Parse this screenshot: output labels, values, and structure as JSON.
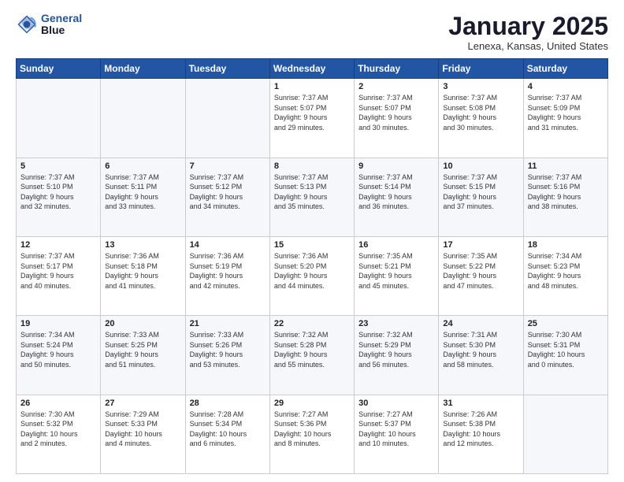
{
  "logo": {
    "line1": "General",
    "line2": "Blue"
  },
  "header": {
    "title": "January 2025",
    "subtitle": "Lenexa, Kansas, United States"
  },
  "weekdays": [
    "Sunday",
    "Monday",
    "Tuesday",
    "Wednesday",
    "Thursday",
    "Friday",
    "Saturday"
  ],
  "weeks": [
    [
      {
        "day": "",
        "info": ""
      },
      {
        "day": "",
        "info": ""
      },
      {
        "day": "",
        "info": ""
      },
      {
        "day": "1",
        "info": "Sunrise: 7:37 AM\nSunset: 5:07 PM\nDaylight: 9 hours\nand 29 minutes."
      },
      {
        "day": "2",
        "info": "Sunrise: 7:37 AM\nSunset: 5:07 PM\nDaylight: 9 hours\nand 30 minutes."
      },
      {
        "day": "3",
        "info": "Sunrise: 7:37 AM\nSunset: 5:08 PM\nDaylight: 9 hours\nand 30 minutes."
      },
      {
        "day": "4",
        "info": "Sunrise: 7:37 AM\nSunset: 5:09 PM\nDaylight: 9 hours\nand 31 minutes."
      }
    ],
    [
      {
        "day": "5",
        "info": "Sunrise: 7:37 AM\nSunset: 5:10 PM\nDaylight: 9 hours\nand 32 minutes."
      },
      {
        "day": "6",
        "info": "Sunrise: 7:37 AM\nSunset: 5:11 PM\nDaylight: 9 hours\nand 33 minutes."
      },
      {
        "day": "7",
        "info": "Sunrise: 7:37 AM\nSunset: 5:12 PM\nDaylight: 9 hours\nand 34 minutes."
      },
      {
        "day": "8",
        "info": "Sunrise: 7:37 AM\nSunset: 5:13 PM\nDaylight: 9 hours\nand 35 minutes."
      },
      {
        "day": "9",
        "info": "Sunrise: 7:37 AM\nSunset: 5:14 PM\nDaylight: 9 hours\nand 36 minutes."
      },
      {
        "day": "10",
        "info": "Sunrise: 7:37 AM\nSunset: 5:15 PM\nDaylight: 9 hours\nand 37 minutes."
      },
      {
        "day": "11",
        "info": "Sunrise: 7:37 AM\nSunset: 5:16 PM\nDaylight: 9 hours\nand 38 minutes."
      }
    ],
    [
      {
        "day": "12",
        "info": "Sunrise: 7:37 AM\nSunset: 5:17 PM\nDaylight: 9 hours\nand 40 minutes."
      },
      {
        "day": "13",
        "info": "Sunrise: 7:36 AM\nSunset: 5:18 PM\nDaylight: 9 hours\nand 41 minutes."
      },
      {
        "day": "14",
        "info": "Sunrise: 7:36 AM\nSunset: 5:19 PM\nDaylight: 9 hours\nand 42 minutes."
      },
      {
        "day": "15",
        "info": "Sunrise: 7:36 AM\nSunset: 5:20 PM\nDaylight: 9 hours\nand 44 minutes."
      },
      {
        "day": "16",
        "info": "Sunrise: 7:35 AM\nSunset: 5:21 PM\nDaylight: 9 hours\nand 45 minutes."
      },
      {
        "day": "17",
        "info": "Sunrise: 7:35 AM\nSunset: 5:22 PM\nDaylight: 9 hours\nand 47 minutes."
      },
      {
        "day": "18",
        "info": "Sunrise: 7:34 AM\nSunset: 5:23 PM\nDaylight: 9 hours\nand 48 minutes."
      }
    ],
    [
      {
        "day": "19",
        "info": "Sunrise: 7:34 AM\nSunset: 5:24 PM\nDaylight: 9 hours\nand 50 minutes."
      },
      {
        "day": "20",
        "info": "Sunrise: 7:33 AM\nSunset: 5:25 PM\nDaylight: 9 hours\nand 51 minutes."
      },
      {
        "day": "21",
        "info": "Sunrise: 7:33 AM\nSunset: 5:26 PM\nDaylight: 9 hours\nand 53 minutes."
      },
      {
        "day": "22",
        "info": "Sunrise: 7:32 AM\nSunset: 5:28 PM\nDaylight: 9 hours\nand 55 minutes."
      },
      {
        "day": "23",
        "info": "Sunrise: 7:32 AM\nSunset: 5:29 PM\nDaylight: 9 hours\nand 56 minutes."
      },
      {
        "day": "24",
        "info": "Sunrise: 7:31 AM\nSunset: 5:30 PM\nDaylight: 9 hours\nand 58 minutes."
      },
      {
        "day": "25",
        "info": "Sunrise: 7:30 AM\nSunset: 5:31 PM\nDaylight: 10 hours\nand 0 minutes."
      }
    ],
    [
      {
        "day": "26",
        "info": "Sunrise: 7:30 AM\nSunset: 5:32 PM\nDaylight: 10 hours\nand 2 minutes."
      },
      {
        "day": "27",
        "info": "Sunrise: 7:29 AM\nSunset: 5:33 PM\nDaylight: 10 hours\nand 4 minutes."
      },
      {
        "day": "28",
        "info": "Sunrise: 7:28 AM\nSunset: 5:34 PM\nDaylight: 10 hours\nand 6 minutes."
      },
      {
        "day": "29",
        "info": "Sunrise: 7:27 AM\nSunset: 5:36 PM\nDaylight: 10 hours\nand 8 minutes."
      },
      {
        "day": "30",
        "info": "Sunrise: 7:27 AM\nSunset: 5:37 PM\nDaylight: 10 hours\nand 10 minutes."
      },
      {
        "day": "31",
        "info": "Sunrise: 7:26 AM\nSunset: 5:38 PM\nDaylight: 10 hours\nand 12 minutes."
      },
      {
        "day": "",
        "info": ""
      }
    ]
  ]
}
